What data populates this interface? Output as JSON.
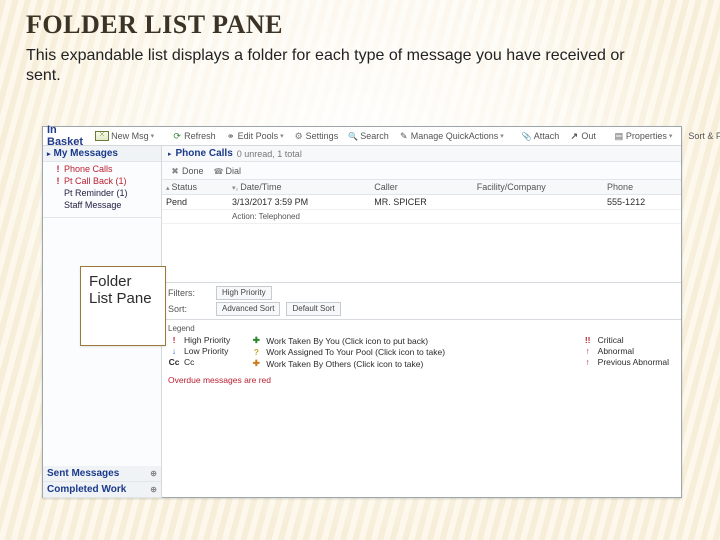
{
  "slide": {
    "title": "FOLDER LIST PANE",
    "description": "This expandable list displays a folder for each type of message you have received or sent."
  },
  "callout": {
    "text": "Folder List Pane"
  },
  "toolbar": {
    "brand": "In Basket",
    "new_msg": "New Msg",
    "refresh": "Refresh",
    "edit_pools": "Edit Pools",
    "settings": "Settings",
    "search": "Search",
    "manage_quickactions": "Manage QuickActions",
    "attach": "Attach",
    "out": "Out",
    "properties": "Properties",
    "sort_filter": "Sort & Filter"
  },
  "sidebar": {
    "header": "My Messages",
    "items": [
      {
        "label": "Phone Calls",
        "flag": false,
        "red": false
      },
      {
        "label": "Pt Call Back (1)",
        "flag": true,
        "red": true
      },
      {
        "label": "Pt Reminder (1)",
        "flag": false,
        "red": false
      },
      {
        "label": "Staff Message",
        "flag": false,
        "red": false
      }
    ],
    "bottom": [
      {
        "label": "Sent Messages"
      },
      {
        "label": "Completed Work"
      }
    ]
  },
  "content": {
    "title_label": "Phone Calls",
    "title_meta": "0 unread, 1 total",
    "sub_toolbar": {
      "done": "Done",
      "dial": "Dial"
    },
    "columns": {
      "status": "Status",
      "datetime": "Date/Time",
      "caller": "Caller",
      "facility": "Facility/Company",
      "phone": "Phone"
    },
    "rows": [
      {
        "status": "Pend",
        "datetime": "3/13/2017 3:59 PM",
        "caller": "MR. SPICER",
        "facility": "",
        "phone": "555-1212",
        "action": "Action: Telephoned"
      }
    ],
    "filters": {
      "filters_label": "Filters:",
      "high_priority": "High Priority",
      "sort_label": "Sort:",
      "advanced_sort": "Advanced Sort",
      "default_sort": "Default Sort"
    },
    "legend": {
      "title": "Legend",
      "col1": [
        {
          "icon": "!",
          "cls": "lg-red",
          "text": "High Priority"
        },
        {
          "icon": "↓",
          "cls": "lg-blue",
          "text": "Low Priority"
        },
        {
          "icon": "Cc",
          "cls": "",
          "text": "Cc"
        }
      ],
      "col2": [
        {
          "icon": "✚",
          "cls": "lg-green",
          "text": "Work Taken By You (Click icon to put back)"
        },
        {
          "icon": "?",
          "cls": "lg-yellow",
          "text": "Work Assigned To Your Pool (Click icon to take)"
        },
        {
          "icon": "✚",
          "cls": "lg-orange",
          "text": "Work Taken By Others (Click icon to take)"
        }
      ],
      "col3": [
        {
          "icon": "!!",
          "cls": "lg-red",
          "text": "Critical"
        },
        {
          "icon": "↑",
          "cls": "lg-red",
          "text": "Abnormal"
        },
        {
          "icon": "↑",
          "cls": "lg-red",
          "text": "Previous Abnormal"
        }
      ]
    },
    "overdue_note": "Overdue messages are red"
  }
}
